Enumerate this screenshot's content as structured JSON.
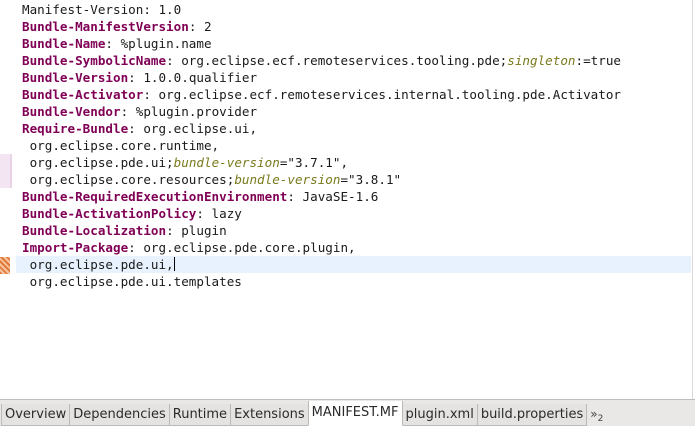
{
  "editor": {
    "lines": [
      {
        "segments": [
          {
            "t": "text",
            "v": "Manifest-Version: 1.0"
          }
        ]
      },
      {
        "segments": [
          {
            "t": "key",
            "v": "Bundle-ManifestVersion"
          },
          {
            "t": "text",
            "v": ": 2"
          }
        ]
      },
      {
        "segments": [
          {
            "t": "key",
            "v": "Bundle-Name"
          },
          {
            "t": "text",
            "v": ": %plugin.name"
          }
        ]
      },
      {
        "segments": [
          {
            "t": "key",
            "v": "Bundle-SymbolicName"
          },
          {
            "t": "text",
            "v": ": org.eclipse.ecf.remoteservices.tooling.pde;"
          },
          {
            "t": "attr",
            "v": "singleton"
          },
          {
            "t": "text",
            "v": ":=true"
          }
        ]
      },
      {
        "segments": [
          {
            "t": "key",
            "v": "Bundle-Version"
          },
          {
            "t": "text",
            "v": ": 1.0.0.qualifier"
          }
        ]
      },
      {
        "segments": [
          {
            "t": "key",
            "v": "Bundle-Activator"
          },
          {
            "t": "text",
            "v": ": org.eclipse.ecf.remoteservices.internal.tooling.pde.Activator"
          }
        ]
      },
      {
        "segments": [
          {
            "t": "key",
            "v": "Bundle-Vendor"
          },
          {
            "t": "text",
            "v": ": %plugin.provider"
          }
        ]
      },
      {
        "segments": [
          {
            "t": "key",
            "v": "Require-Bundle"
          },
          {
            "t": "text",
            "v": ": org.eclipse.ui,"
          }
        ]
      },
      {
        "segments": [
          {
            "t": "text",
            "v": " org.eclipse.core.runtime,"
          }
        ]
      },
      {
        "segments": [
          {
            "t": "text",
            "v": " org.eclipse.pde.ui;"
          },
          {
            "t": "attr",
            "v": "bundle-version"
          },
          {
            "t": "text",
            "v": "=\"3.7.1\","
          }
        ]
      },
      {
        "segments": [
          {
            "t": "text",
            "v": " org.eclipse.core.resources;"
          },
          {
            "t": "attr",
            "v": "bundle-version"
          },
          {
            "t": "text",
            "v": "=\"3.8.1\""
          }
        ]
      },
      {
        "segments": [
          {
            "t": "key",
            "v": "Bundle-RequiredExecutionEnvironment"
          },
          {
            "t": "text",
            "v": ": JavaSE-1.6"
          }
        ]
      },
      {
        "segments": [
          {
            "t": "key",
            "v": "Bundle-ActivationPolicy"
          },
          {
            "t": "text",
            "v": ": lazy"
          }
        ]
      },
      {
        "segments": [
          {
            "t": "key",
            "v": "Bundle-Localization"
          },
          {
            "t": "text",
            "v": ": plugin"
          }
        ]
      },
      {
        "segments": [
          {
            "t": "key",
            "v": "Import-Package"
          },
          {
            "t": "text",
            "v": ": org.eclipse.pde.core.plugin,"
          }
        ]
      },
      {
        "segments": [
          {
            "t": "text",
            "v": " org.eclipse.pde.ui,"
          }
        ],
        "current": true,
        "caret": true
      },
      {
        "segments": [
          {
            "t": "text",
            "v": " org.eclipse.pde.ui.templates"
          }
        ]
      }
    ]
  },
  "gutter": {
    "change_marker_icon": "change-marker-icon",
    "warning_marker_icon": "warning-marker-icon"
  },
  "tabs": [
    {
      "label": "Overview",
      "name": "tab-overview",
      "active": false
    },
    {
      "label": "Dependencies",
      "name": "tab-dependencies",
      "active": false
    },
    {
      "label": "Runtime",
      "name": "tab-runtime",
      "active": false
    },
    {
      "label": "Extensions",
      "name": "tab-extensions",
      "active": false
    },
    {
      "label": "MANIFEST.MF",
      "name": "tab-manifest-mf",
      "active": true
    },
    {
      "label": "plugin.xml",
      "name": "tab-plugin-xml",
      "active": false
    },
    {
      "label": "build.properties",
      "name": "tab-build-properties",
      "active": false
    }
  ],
  "overflow": {
    "chevron": "»",
    "count": "2",
    "icon": "chevron-overflow-icon"
  },
  "colors": {
    "key": "#7f0055",
    "attribute": "#7a7a1e",
    "current_line": "#e8f2fe",
    "warning_marker": "#e07a3a",
    "change_marker": "#f3e6f2"
  }
}
